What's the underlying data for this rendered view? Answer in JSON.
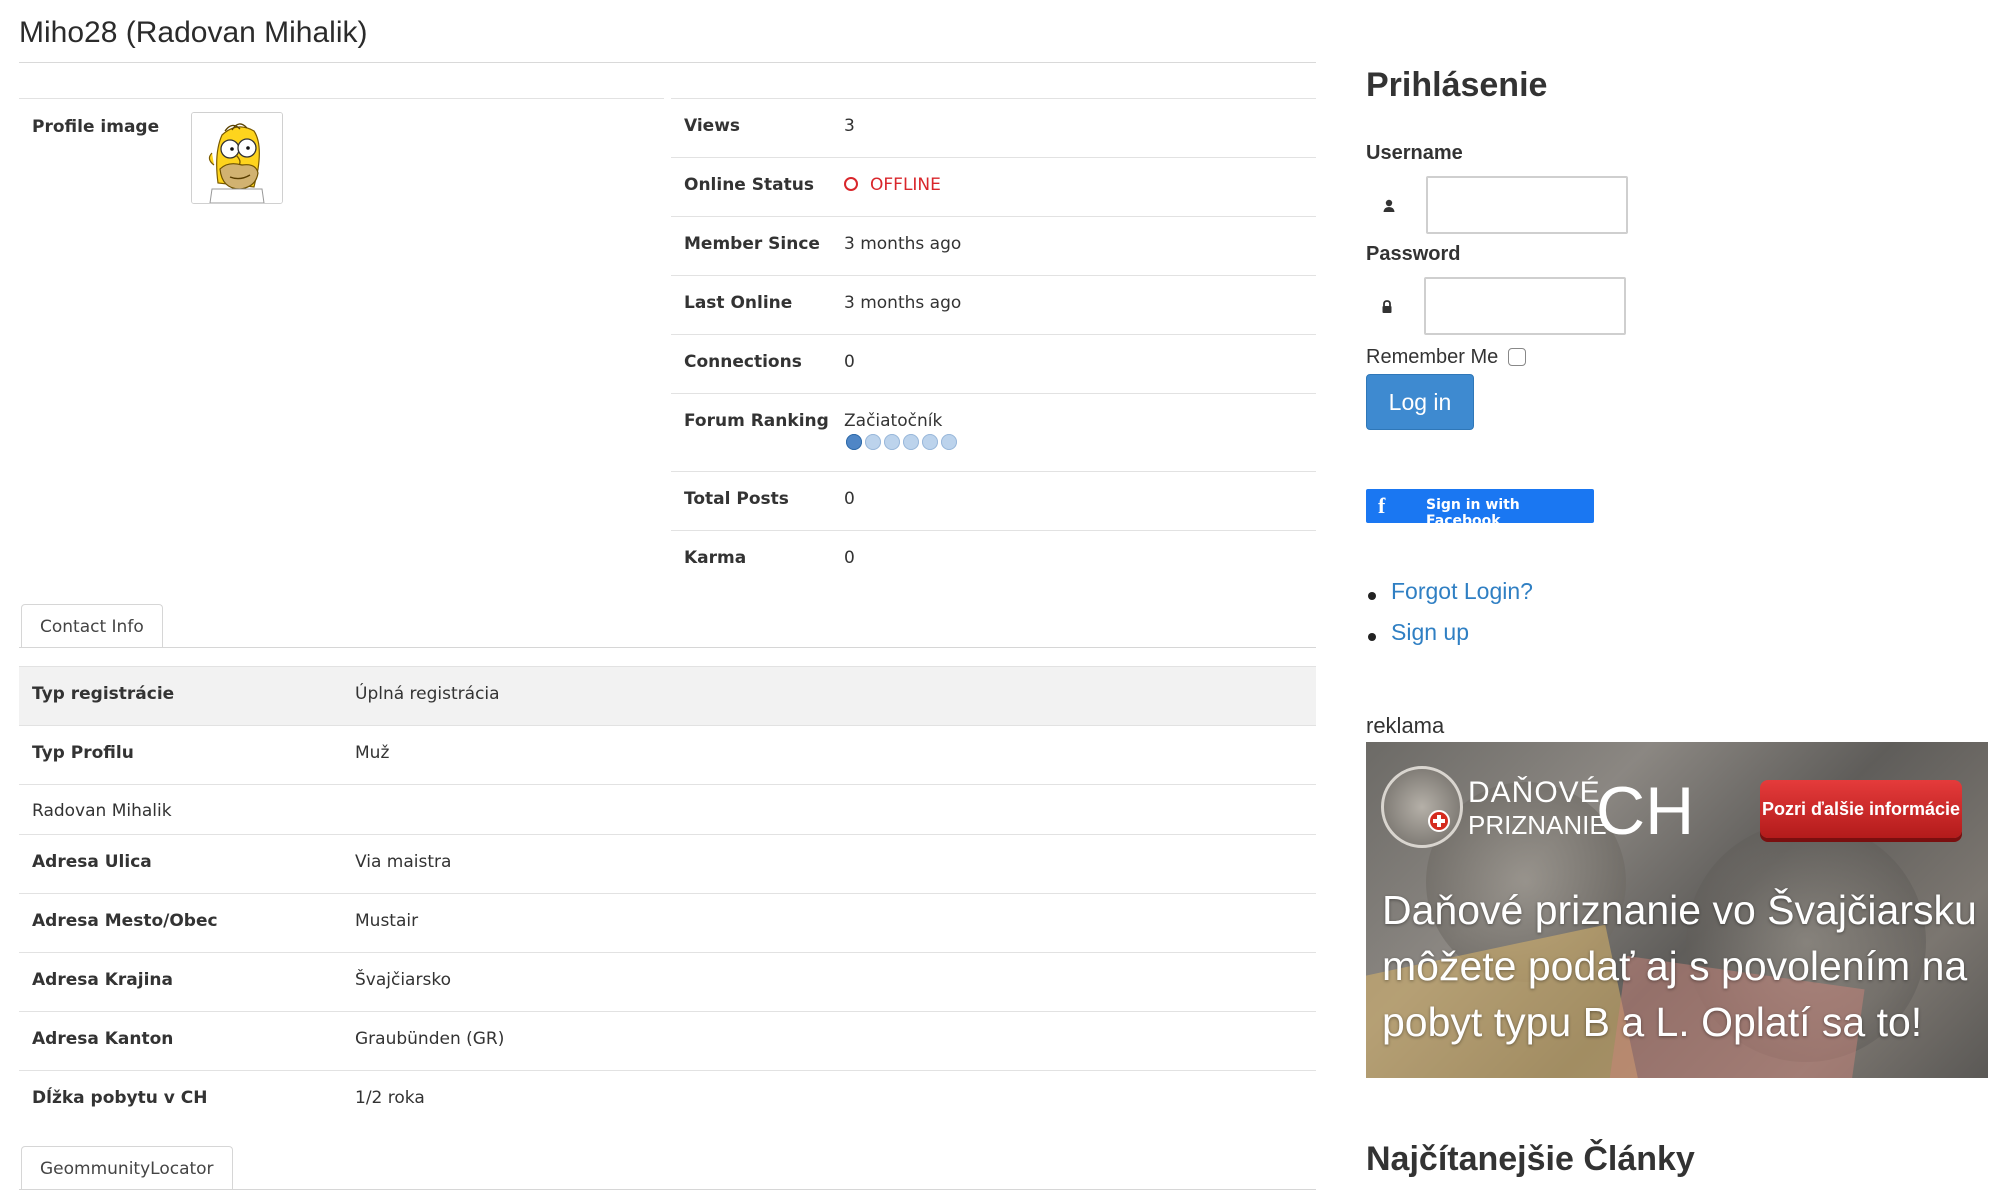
{
  "page": {
    "title": "Miho28 (Radovan Mihalik)"
  },
  "profile": {
    "image_label": "Profile image",
    "avatar_icon": "homer-simpson-avatar"
  },
  "stats": [
    {
      "label": "Views",
      "value": "3"
    },
    {
      "label": "Online Status",
      "value": "OFFLINE"
    },
    {
      "label": "Member Since",
      "value": "3 months ago"
    },
    {
      "label": "Last Online",
      "value": "3 months ago"
    },
    {
      "label": "Connections",
      "value": "0"
    },
    {
      "label": "Forum Ranking",
      "value": "Začiatočník",
      "rank_level": 1,
      "rank_max": 6
    },
    {
      "label": "Total Posts",
      "value": "0"
    },
    {
      "label": "Karma",
      "value": "0"
    }
  ],
  "tabs": {
    "contact": "Contact Info",
    "locator": "GeommunityLocator"
  },
  "contact": [
    {
      "label": "Typ registrácie",
      "value": "Úplná registrácia"
    },
    {
      "label": "Typ Profilu",
      "value": "Muž"
    },
    {
      "label": "Radovan Mihalik",
      "value": ""
    },
    {
      "label": "Adresa Ulica",
      "value": "Via maistra"
    },
    {
      "label": "Adresa Mesto/Obec",
      "value": "Mustair"
    },
    {
      "label": "Adresa Krajina",
      "value": "Švajčiarsko"
    },
    {
      "label": "Adresa Kanton",
      "value": "Graubünden (GR)"
    },
    {
      "label": "Dĺžka pobytu v CH",
      "value": "1/2 roka"
    }
  ],
  "login": {
    "heading": "Prihlásenie",
    "username_label": "Username",
    "password_label": "Password",
    "username_value": "",
    "password_value": "",
    "remember_label": "Remember Me",
    "remember_checked": false,
    "login_button": "Log in",
    "facebook_button": "Sign in with Facebook",
    "links": [
      "Forgot Login?",
      "Sign up"
    ]
  },
  "ad": {
    "label": "reklama",
    "brand_line1": "DAŇOVÉ",
    "brand_line2": "PRIZNANIE",
    "brand_ch": "CH",
    "cta": "Pozri ďalšie informácie",
    "headline": "Daňové priznanie vo Švajčiarsku môžete podať aj s povolením na pobyt typu B a L. Oplatí sa to!"
  },
  "popular_heading": "Najčítanejšie Články",
  "colors": {
    "offline": "#d9262b",
    "link": "#2f7fc3",
    "login_button": "#3e8ad0",
    "facebook": "#1a77f2"
  }
}
